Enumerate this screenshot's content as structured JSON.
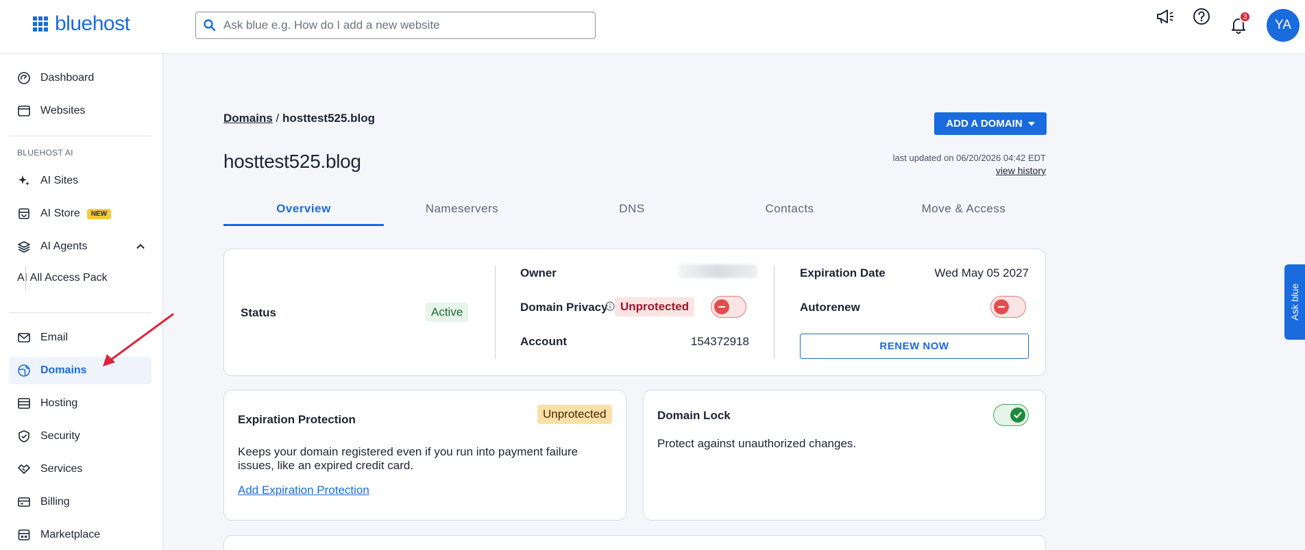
{
  "header": {
    "logo_text": "bluehost",
    "search_placeholder": "Ask blue e.g. How do I add a new website",
    "notification_count": "3",
    "avatar_initials": "YA"
  },
  "sidebar": {
    "items_top": [
      {
        "label": "Dashboard",
        "icon": "dashboard-icon"
      },
      {
        "label": "Websites",
        "icon": "browser-icon"
      }
    ],
    "section_label": "BLUEHOST AI",
    "ai_items": [
      {
        "label": "AI Sites",
        "icon": "sparkle-icon"
      },
      {
        "label": "AI Store",
        "icon": "store-icon",
        "badge": "NEW"
      },
      {
        "label": "AI Agents",
        "icon": "layers-icon"
      },
      {
        "label": "AI All Access Pack"
      }
    ],
    "items_bottom": [
      {
        "label": "Email",
        "icon": "mail-icon"
      },
      {
        "label": "Domains",
        "icon": "globe-icon",
        "active": true
      },
      {
        "label": "Hosting",
        "icon": "server-icon"
      },
      {
        "label": "Security",
        "icon": "shield-icon"
      },
      {
        "label": "Services",
        "icon": "handshake-icon"
      },
      {
        "label": "Billing",
        "icon": "credit-card-icon"
      },
      {
        "label": "Marketplace",
        "icon": "marketplace-icon"
      }
    ]
  },
  "breadcrumb": {
    "root": "Domains",
    "separator": " / ",
    "current": "hosttest525.blog"
  },
  "page_title": "hosttest525.blog",
  "add_domain_label": "ADD A DOMAIN",
  "updated": {
    "text": "last updated on 06/20/2026 04:42 EDT",
    "history_link": "view history"
  },
  "tabs": [
    "Overview",
    "Nameservers",
    "DNS",
    "Contacts",
    "Move & Access"
  ],
  "summary": {
    "status_label": "Status",
    "status_value": "Active",
    "owner_label": "Owner",
    "privacy_label": "Domain Privacy",
    "privacy_value": "Unprotected",
    "account_label": "Account",
    "account_value": "154372918",
    "expiration_label": "Expiration Date",
    "expiration_value": "Wed May 05 2027",
    "autorenew_label": "Autorenew",
    "renew_button": "RENEW NOW"
  },
  "expiration_protection": {
    "title": "Expiration Protection",
    "badge": "Unprotected",
    "description": "Keeps your domain registered even if you run into payment failure issues, like an expired credit card.",
    "link": "Add Expiration Protection"
  },
  "domain_lock": {
    "title": "Domain Lock",
    "description": "Protect against unauthorized changes."
  },
  "ask_blue_label": "Ask blue",
  "colors": {
    "brand": "#196bde",
    "danger": "#e24d4d",
    "success": "#1e8a3c",
    "arrow": "#e0213a"
  }
}
